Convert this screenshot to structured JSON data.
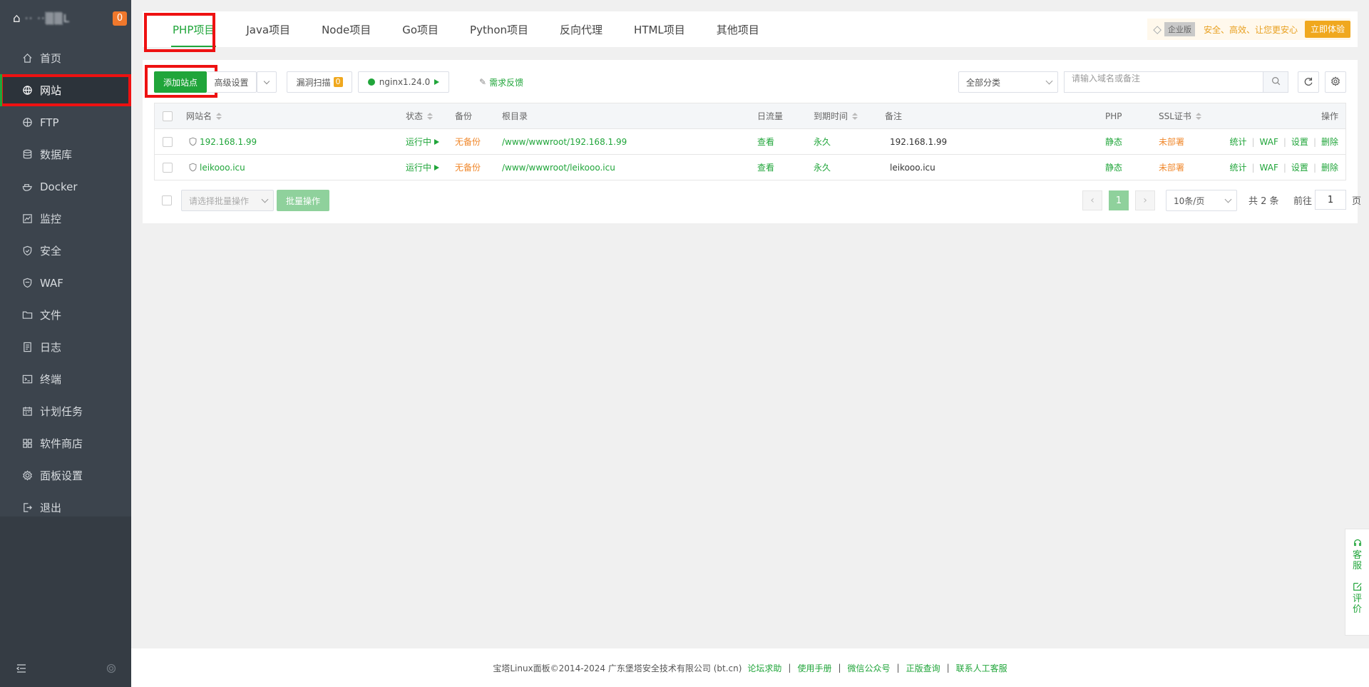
{
  "sidebar": {
    "logo_text": "·· ··▒▒L",
    "notification_count": "0",
    "items": [
      {
        "label": "首页",
        "icon": "home-icon"
      },
      {
        "label": "网站",
        "icon": "globe-icon"
      },
      {
        "label": "FTP",
        "icon": "ftp-icon"
      },
      {
        "label": "数据库",
        "icon": "database-icon"
      },
      {
        "label": "Docker",
        "icon": "docker-icon"
      },
      {
        "label": "监控",
        "icon": "monitor-icon"
      },
      {
        "label": "安全",
        "icon": "shield-icon"
      },
      {
        "label": "WAF",
        "icon": "waf-icon"
      },
      {
        "label": "文件",
        "icon": "folder-icon"
      },
      {
        "label": "日志",
        "icon": "log-icon"
      },
      {
        "label": "终端",
        "icon": "terminal-icon"
      },
      {
        "label": "计划任务",
        "icon": "calendar-icon"
      },
      {
        "label": "软件商店",
        "icon": "apps-icon"
      },
      {
        "label": "面板设置",
        "icon": "gear-icon"
      },
      {
        "label": "退出",
        "icon": "logout-icon"
      }
    ],
    "active_index": 1
  },
  "tabs": [
    "PHP项目",
    "Java项目",
    "Node项目",
    "Go项目",
    "Python项目",
    "反向代理",
    "HTML项目",
    "其他项目"
  ],
  "promo": {
    "tag": "企业版",
    "text": "安全、高效、让您更安心",
    "button": "立即体验"
  },
  "toolbar": {
    "add_site": "添加站点",
    "advanced": "高级设置",
    "vuln_scan": "漏洞扫描",
    "vuln_count": "0",
    "nginx": "nginx1.24.0",
    "feedback": "需求反馈",
    "category": "全部分类",
    "search_placeholder": "请输入域名或备注"
  },
  "table": {
    "headers": {
      "name": "网站名",
      "status": "状态",
      "backup": "备份",
      "root": "根目录",
      "traffic": "日流量",
      "expire": "到期时间",
      "note": "备注",
      "php": "PHP",
      "ssl": "SSL证书",
      "ops": "操作"
    },
    "rows": [
      {
        "name": "192.168.1.99",
        "status": "运行中",
        "backup": "无备份",
        "root": "/www/wwwroot/192.168.1.99",
        "traffic": "查看",
        "expire": "永久",
        "note": "192.168.1.99",
        "php": "静态",
        "ssl": "未部署"
      },
      {
        "name": "leikooo.icu",
        "status": "运行中",
        "backup": "无备份",
        "root": "/www/wwwroot/leikooo.icu",
        "traffic": "查看",
        "expire": "永久",
        "note": "leikooo.icu",
        "php": "静态",
        "ssl": "未部署"
      }
    ],
    "ops": [
      "统计",
      "WAF",
      "设置",
      "删除"
    ]
  },
  "batch": {
    "select_placeholder": "请选择批量操作",
    "button": "批量操作"
  },
  "pager": {
    "current": "1",
    "per_page": "10条/页",
    "total": "共 2 条",
    "goto_prefix": "前往",
    "goto_value": "1",
    "goto_suffix": "页"
  },
  "footer": {
    "copyright": "宝塔Linux面板©2014-2024 广东堡塔安全技术有限公司 (bt.cn)",
    "links": [
      "论坛求助",
      "使用手册",
      "微信公众号",
      "正版查询",
      "联系人工客服"
    ]
  },
  "float": {
    "service": "客\n服",
    "review": "评\n价"
  },
  "colors": {
    "accent": "#20a53a",
    "sidebar_bg": "#3c444d",
    "warning": "#f0882c",
    "highlight": "#ee1111"
  }
}
